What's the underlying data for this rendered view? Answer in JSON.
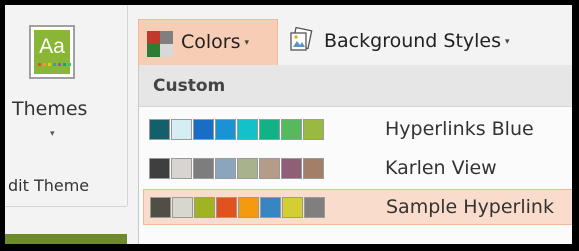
{
  "left_panel": {
    "thumbnail_text": "Aa",
    "themes_label": "Themes",
    "themes_arrow": "▾",
    "edit_theme_label": "dit Theme",
    "thumbnail_dot_colors": [
      "#e84c3d",
      "#f39c12",
      "#f1c40f",
      "#3498db",
      "#9b59b6",
      "#16a085",
      "#2ecc71"
    ]
  },
  "toolbar": {
    "colors_label": "Colors",
    "colors_arrow": "▾",
    "colors_icon_colors": [
      "#c0392b",
      "#7f7f7f",
      "#2e7d32",
      "#d8d8d8"
    ],
    "background_styles_label": "Background Styles",
    "background_styles_arrow": "▾"
  },
  "menu": {
    "header": "Custom",
    "items": [
      {
        "label": "Hyperlinks Blue",
        "selected": false,
        "swatches": [
          "#135f6c",
          "#d6eef3",
          "#1a6dc4",
          "#1a93d5",
          "#12c1c9",
          "#12b286",
          "#58b85e",
          "#99b942"
        ]
      },
      {
        "label": "Karlen View",
        "selected": false,
        "swatches": [
          "#3f3f3f",
          "#d8d4cf",
          "#7d7d7d",
          "#8ba5bd",
          "#a8b28d",
          "#b59c88",
          "#8f5f76",
          "#a37e68"
        ]
      },
      {
        "label": "Sample Hyperlink",
        "selected": true,
        "swatches": [
          "#4f4f45",
          "#d7d6cf",
          "#a0b423",
          "#e05321",
          "#f49a0e",
          "#3686c3",
          "#d3ce31",
          "#7f7f7f"
        ]
      }
    ]
  }
}
